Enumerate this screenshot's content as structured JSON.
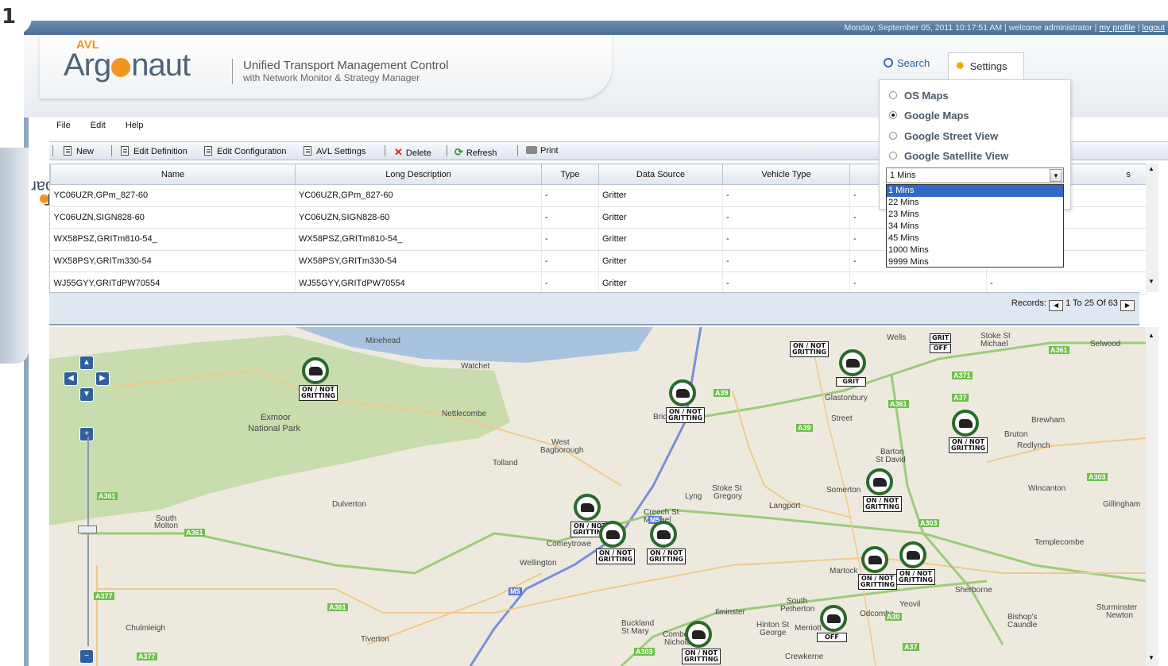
{
  "step_badge": "1",
  "topbar": {
    "datetime": "Monday, September 05, 2011 10:17:51 AM",
    "welcome": "welcome administrator",
    "my_profile": "my profile",
    "logout": "logout"
  },
  "header": {
    "logo_prefix": "AVL",
    "logo_part1": "Arg",
    "logo_part2": "naut",
    "tagline1": "Unified Transport Management Control",
    "tagline2": "with Network Monitor & Strategy Manager",
    "search_label": "Search",
    "settings_label": "Settings"
  },
  "settings_panel": {
    "options": [
      {
        "label": "OS Maps",
        "selected": false
      },
      {
        "label": "Google Maps",
        "selected": true
      },
      {
        "label": "Google Street View",
        "selected": false
      },
      {
        "label": "Google Satellite View",
        "selected": false
      }
    ],
    "refresh_value": "1 Mins",
    "refresh_options": [
      "1 Mins",
      "22 Mins",
      "23 Mins",
      "34 Mins",
      "45 Mins",
      "1000 Mins",
      "9999 Mins"
    ]
  },
  "toolbar_tab": {
    "label_start": "T",
    "label_end": "olbar"
  },
  "menu": [
    "File",
    "Edit",
    "Help"
  ],
  "actions": {
    "new": "New",
    "edit_definition": "Edit Definition",
    "edit_configuration": "Edit Configuration",
    "avl_settings": "AVL Settings",
    "delete": "Delete",
    "refresh": "Refresh",
    "print": "Print"
  },
  "grid": {
    "columns": [
      "Name",
      "Long Description",
      "Type",
      "Data Source",
      "Vehicle Type",
      "",
      "s"
    ],
    "rows": [
      [
        "YC06UZR,GPm_827-60",
        "YC06UZR,GPm_827-60",
        "-",
        "Gritter",
        "-",
        "-",
        ""
      ],
      [
        "YC06UZN,SIGN828-60",
        "YC06UZN,SIGN828-60",
        "-",
        "Gritter",
        "-",
        "-",
        ""
      ],
      [
        "WX58PSZ,GRITm810-54_",
        "WX58PSZ,GRITm810-54_",
        "-",
        "Gritter",
        "-",
        "-",
        ""
      ],
      [
        "WX58PSY,GRITm330-54",
        "WX58PSY,GRITm330-54",
        "-",
        "Gritter",
        "-",
        "-",
        ""
      ],
      [
        "WJ55GYY,GRITdPW70554",
        "WJ55GYY,GRITdPW70554",
        "-",
        "Gritter",
        "-",
        "-",
        "-"
      ]
    ]
  },
  "pager": {
    "label": "Records:",
    "range": "1 To 25 Of 63"
  },
  "map": {
    "places": [
      {
        "name": "Minehead"
      },
      {
        "name": "Watchet"
      },
      {
        "name": "Exmoor"
      },
      {
        "name": "National Park"
      },
      {
        "name": "Nettlecombe"
      },
      {
        "name": "West"
      },
      {
        "name": "Bagborough"
      },
      {
        "name": "Tolland"
      },
      {
        "name": "Dulverton"
      },
      {
        "name": "South"
      },
      {
        "name": "Molton"
      },
      {
        "name": "Wellington"
      },
      {
        "name": "Lyng"
      },
      {
        "name": "Stoke St"
      },
      {
        "name": "Gregory"
      },
      {
        "name": "Langport"
      },
      {
        "name": "Somerton"
      },
      {
        "name": "Street"
      },
      {
        "name": "Glastonbury"
      },
      {
        "name": "Wells"
      },
      {
        "name": "Barton"
      },
      {
        "name": "St David"
      },
      {
        "name": "Brewham"
      },
      {
        "name": "Bruton"
      },
      {
        "name": "Redlynch"
      },
      {
        "name": "Wincanton"
      },
      {
        "name": "Gillingham"
      },
      {
        "name": "Templecombe"
      },
      {
        "name": "Martock"
      },
      {
        "name": "Sherborne"
      },
      {
        "name": "Yeovil"
      },
      {
        "name": "Stoke St"
      },
      {
        "name": "Michael"
      },
      {
        "name": "Selwood"
      },
      {
        "name": "Chulmleigh"
      },
      {
        "name": "Tiverton"
      },
      {
        "name": "Buckland"
      },
      {
        "name": "St Mary"
      },
      {
        "name": "Combe St"
      },
      {
        "name": "Nicholas"
      },
      {
        "name": "Ilminster"
      },
      {
        "name": "South"
      },
      {
        "name": "Petherton"
      },
      {
        "name": "Hinton St"
      },
      {
        "name": "George"
      },
      {
        "name": "Merriott"
      },
      {
        "name": "Crewkerne"
      },
      {
        "name": "Odcombe"
      },
      {
        "name": "Bishop's"
      },
      {
        "name": "Caundle"
      },
      {
        "name": "Sturminster"
      },
      {
        "name": "Newton"
      },
      {
        "name": "Creech St"
      },
      {
        "name": "Michael"
      },
      {
        "name": "Comeytrowe"
      },
      {
        "name": "Bridgwater"
      }
    ],
    "roads": [
      "A39",
      "A39",
      "A361",
      "A371",
      "A37",
      "A361",
      "A303",
      "A303",
      "A361",
      "A377",
      "A361",
      "A377",
      "A303",
      "A30",
      "A37",
      "M5",
      "M5",
      "A361"
    ],
    "vehicle_labels": [
      "ON / NOT\nGRITTING",
      "GRIT",
      "OFF"
    ]
  }
}
